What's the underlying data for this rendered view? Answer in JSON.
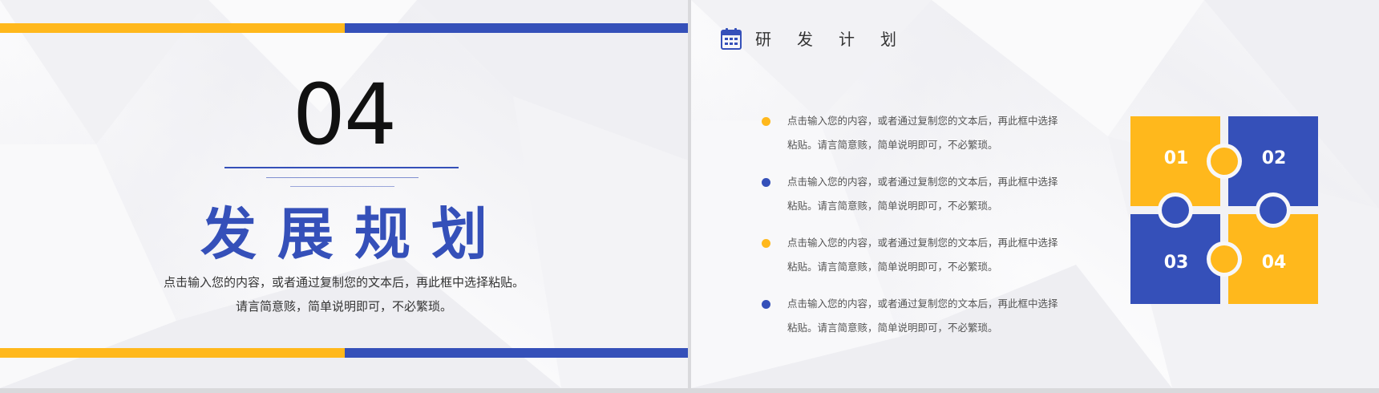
{
  "colors": {
    "yellow": "#ffb81c",
    "blue": "#3550b9",
    "text": "#333333"
  },
  "left_slide": {
    "number": "04",
    "title": "发展规划",
    "description_line1": "点击输入您的内容，或者通过复制您的文本后，再此框中选择粘贴。",
    "description_line2": "请言简意赅，简单说明即可，不必繁琐。"
  },
  "right_slide": {
    "icon": "calendar-icon",
    "section_title": "研发计划",
    "items": [
      {
        "color": "#ffb81c",
        "line1": "点击输入您的内容，或者通过复制您的文本后，再此框中选择",
        "line2": "粘贴。请言简意赅，简单说明即可，不必繁琐。"
      },
      {
        "color": "#3550b9",
        "line1": "点击输入您的内容，或者通过复制您的文本后，再此框中选择",
        "line2": "粘贴。请言简意赅，简单说明即可，不必繁琐。"
      },
      {
        "color": "#ffb81c",
        "line1": "点击输入您的内容，或者通过复制您的文本后，再此框中选择",
        "line2": "粘贴。请言简意赅，简单说明即可，不必繁琐。"
      },
      {
        "color": "#3550b9",
        "line1": "点击输入您的内容，或者通过复制您的文本后，再此框中选择",
        "line2": "粘贴。请言简意赅，简单说明即可，不必繁琐。"
      }
    ],
    "puzzle": [
      {
        "label": "01",
        "color": "#ffb81c"
      },
      {
        "label": "02",
        "color": "#3550b9"
      },
      {
        "label": "03",
        "color": "#3550b9"
      },
      {
        "label": "04",
        "color": "#ffb81c"
      }
    ]
  }
}
